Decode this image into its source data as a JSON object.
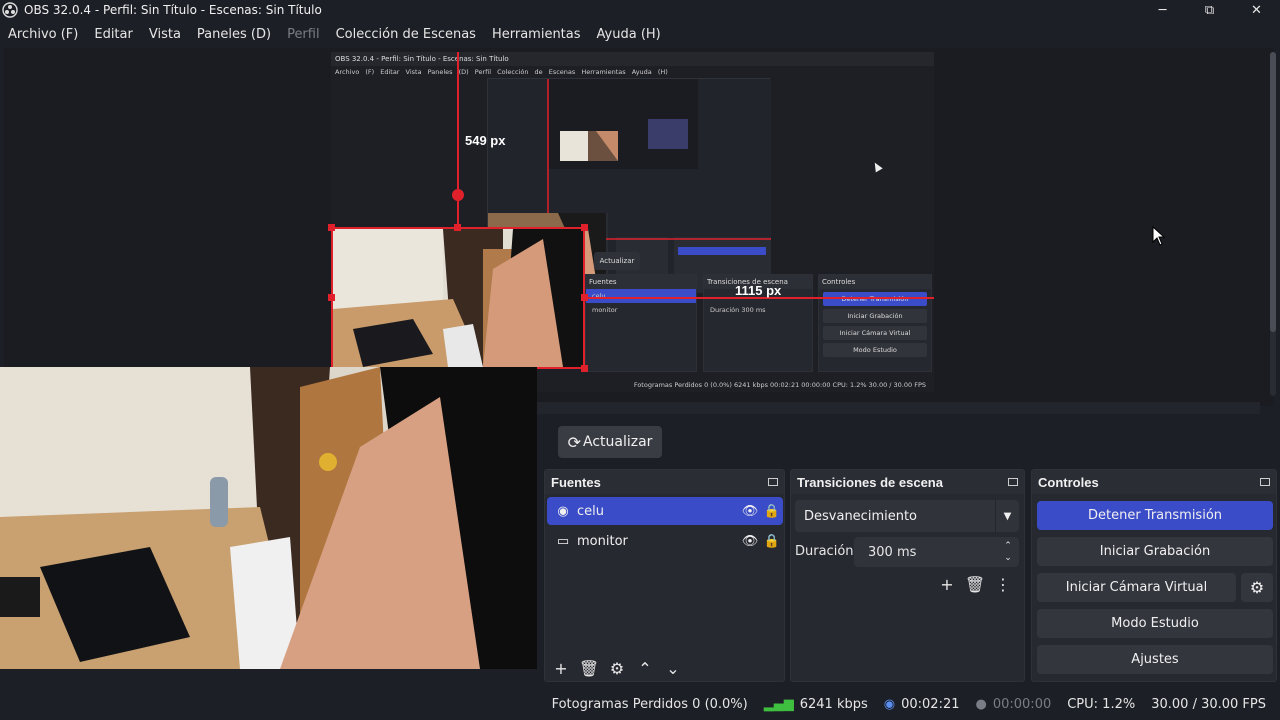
{
  "window": {
    "title": "OBS 32.0.4 - Perfil: Sin Título - Escenas: Sin Título",
    "minimize": "─",
    "restore": "⧉",
    "close": "✕"
  },
  "menu": [
    "Archivo (F)",
    "Editar",
    "Vista",
    "Paneles (D)",
    "Perfil",
    "Colección de Escenas",
    "Herramientas",
    "Ayuda (H)"
  ],
  "preview": {
    "guide_top_label": "549 px",
    "guide_right_label": "1115 px",
    "nested": {
      "title": "OBS 32.0.4 - Perfil: Sin Título - Escenas: Sin Título",
      "menu": "Archivo (F)  Editar  Vista  Paneles (D)  Perfil  Colección de Escenas  Herramientas  Ayuda (H)",
      "refresh": "Actualizar",
      "sources_title": "Fuentes",
      "source_1": "celu",
      "source_2": "monitor",
      "transitions_title": "Transiciones de escena",
      "duration_label": "Duración",
      "duration_value": "300 ms",
      "controls_title": "Controles",
      "btn_stop": "Detener Transmisión",
      "btn_record": "Iniciar Grabación",
      "btn_vcam": "Iniciar Cámara Virtual",
      "btn_studio": "Modo Estudio",
      "btn_settings": "Ajustes",
      "status": "Fotogramas Perdidos 0 (0.0%)   6241 kbps   00:02:21   00:00:00   CPU: 1.2%   30.00 / 30.00 FPS"
    }
  },
  "refresh_button": "Actualizar",
  "sources": {
    "title": "Fuentes",
    "items": [
      {
        "name": "celu",
        "selected": true,
        "icon": "camera-icon"
      },
      {
        "name": "monitor",
        "selected": false,
        "icon": "monitor-icon"
      }
    ]
  },
  "transitions": {
    "title": "Transiciones de escena",
    "selected": "Desvanecimiento",
    "duration_label": "Duración",
    "duration_value": "300 ms"
  },
  "controls": {
    "title": "Controles",
    "stop_stream": "Detener Transmisión",
    "start_recording": "Iniciar Grabación",
    "start_virtual_cam": "Iniciar Cámara Virtual",
    "studio_mode": "Modo Estudio",
    "settings": "Ajustes"
  },
  "status": {
    "dropped_frames": "Fotogramas Perdidos 0 (0.0%)",
    "bitrate": "6241 kbps",
    "stream_time": "00:02:21",
    "record_time": "00:00:00",
    "cpu": "CPU: 1.2%",
    "fps": "30.00 / 30.00 FPS"
  },
  "colors": {
    "accent": "#3b4cc8",
    "selection_red": "#e0202a",
    "bitrate_green": "#3fbf3f",
    "live_blue": "#5a8ef0"
  }
}
